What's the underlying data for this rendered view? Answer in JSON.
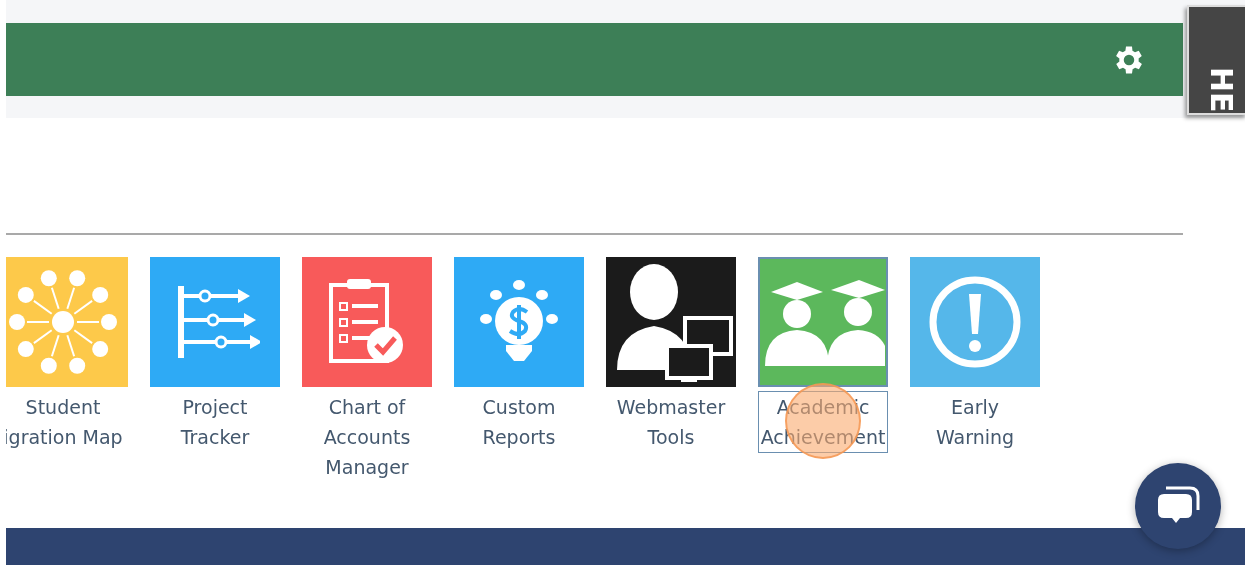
{
  "side_tab": {
    "label": "HE"
  },
  "tiles": [
    {
      "label": "Student\nigration Map",
      "color": "#fdc94a",
      "selected": false
    },
    {
      "label": "Project\nTracker",
      "color": "#2eaaf5",
      "selected": false
    },
    {
      "label": "Chart of\nAccounts\nManager",
      "color": "#f85a5a",
      "selected": false
    },
    {
      "label": "Custom\nReports",
      "color": "#2eaaf5",
      "selected": false
    },
    {
      "label": "Webmaster\nTools",
      "color": "#1b1b1b",
      "selected": false
    },
    {
      "label": "Academic\nAchievement",
      "color": "#5cb85c",
      "selected": true
    },
    {
      "label": "Early\nWarning",
      "color": "#55b7ea",
      "selected": false
    }
  ]
}
